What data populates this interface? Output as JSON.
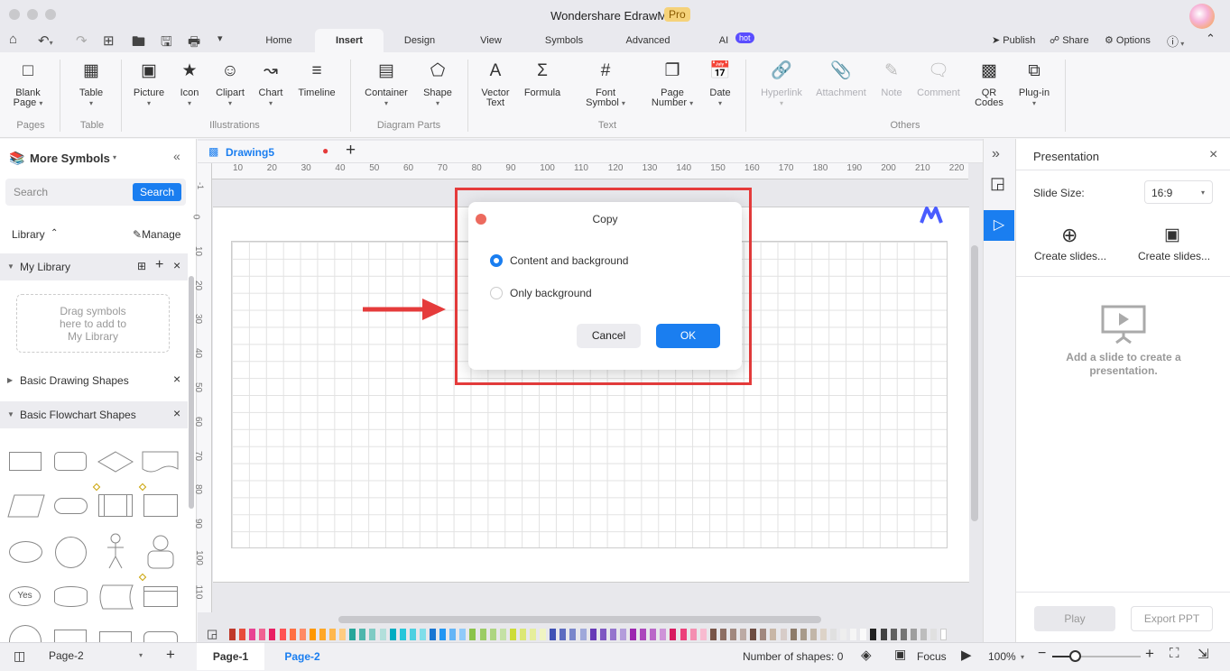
{
  "window": {
    "title": "Wondershare EdrawMax",
    "badge": "Pro"
  },
  "menu_tabs": [
    "Home",
    "Insert",
    "Design",
    "View",
    "Symbols",
    "Advanced",
    "AI"
  ],
  "ai_badge": "hot",
  "top_actions": {
    "publish": "Publish",
    "share": "Share",
    "options": "Options"
  },
  "ribbon": {
    "pages": {
      "blank_page_1": "Blank",
      "blank_page_2": "Page",
      "group": "Pages"
    },
    "table": {
      "label": "Table",
      "group": "Table"
    },
    "illustrations": {
      "picture": "Picture",
      "icon": "Icon",
      "clipart": "Clipart",
      "chart": "Chart",
      "timeline": "Timeline",
      "group": "Illustrations"
    },
    "diagram_parts": {
      "container": "Container",
      "shape": "Shape",
      "group": "Diagram Parts"
    },
    "text": {
      "vector_1": "Vector",
      "vector_2": "Text",
      "formula": "Formula",
      "font_symbol_1": "Font",
      "font_symbol_2": "Symbol",
      "page_number_1": "Page",
      "page_number_2": "Number",
      "date": "Date",
      "group": "Text"
    },
    "others": {
      "hyperlink": "Hyperlink",
      "attachment": "Attachment",
      "note": "Note",
      "comment": "Comment",
      "qr_1": "QR",
      "qr_2": "Codes",
      "plugin": "Plug-in",
      "group": "Others"
    }
  },
  "left_panel": {
    "title": "More Symbols",
    "search_placeholder": "Search",
    "search_button": "Search",
    "library": "Library",
    "manage": "Manage",
    "my_library": "My Library",
    "drag_hint_1": "Drag symbols",
    "drag_hint_2": "here to add to",
    "drag_hint_3": "My Library",
    "basic_drawing": "Basic Drawing Shapes",
    "basic_flowchart": "Basic Flowchart Shapes",
    "yes_shape": "Yes"
  },
  "document_tab": "Drawing5",
  "ruler_h": [
    "10",
    "20",
    "30",
    "40",
    "50",
    "60",
    "70",
    "80",
    "90",
    "100",
    "110",
    "120",
    "130",
    "140",
    "150",
    "160",
    "170",
    "180",
    "190",
    "200",
    "210",
    "220"
  ],
  "ruler_v": [
    "0",
    "10",
    "20",
    "30",
    "40",
    "50",
    "60",
    "70",
    "80",
    "90",
    "100",
    "110"
  ],
  "ruler_v_top": "-1",
  "dialog": {
    "title": "Copy",
    "option1": "Content and background",
    "option2": "Only background",
    "cancel": "Cancel",
    "ok": "OK"
  },
  "right_panel": {
    "title": "Presentation",
    "slide_size_label": "Slide Size:",
    "slide_size_value": "16:9",
    "create1": "Create slides...",
    "create2": "Create slides...",
    "empty_1": "Add a slide to create a",
    "empty_2": "presentation.",
    "play": "Play",
    "export": "Export PPT"
  },
  "status": {
    "page_select": "Page-2",
    "page1": "Page-1",
    "page2": "Page-2",
    "shapes": "Number of shapes: 0",
    "focus": "Focus",
    "zoom": "100%"
  },
  "palette": [
    "#c0392b",
    "#e74c3c",
    "#e84393",
    "#f06292",
    "#e91e63",
    "#ff5252",
    "#ff7043",
    "#ff8a65",
    "#ff9800",
    "#ffa726",
    "#ffb74d",
    "#ffcc80",
    "#26a69a",
    "#4db6ac",
    "#80cbc4",
    "#b2dfdb",
    "#00acc1",
    "#26c6da",
    "#4dd0e1",
    "#80deea",
    "#1976d2",
    "#2196f3",
    "#64b5f6",
    "#90caf9",
    "#8bc34a",
    "#9ccc65",
    "#aed581",
    "#c5e1a5",
    "#cddc39",
    "#dce775",
    "#e6ee9c",
    "#f0f4c3",
    "#3f51b5",
    "#5c6bc0",
    "#7986cb",
    "#9fa8da",
    "#673ab7",
    "#7e57c2",
    "#9575cd",
    "#b39ddb",
    "#9c27b0",
    "#ab47bc",
    "#ba68c8",
    "#ce93d8",
    "#d81b60",
    "#ec407a",
    "#f48fb1",
    "#f8bbd0",
    "#795548",
    "#8d6e63",
    "#a1887f",
    "#bcaaa4",
    "#6d4c41",
    "#a1887f",
    "#c8b6a6",
    "#d7ccc8",
    "#8d7b6a",
    "#a89a8a",
    "#c2b6a8",
    "#ddd3c8",
    "#e0e0e0",
    "#eeeeee",
    "#f5f5f5",
    "#fafafa",
    "#212121",
    "#424242",
    "#616161",
    "#757575",
    "#9e9e9e",
    "#bdbdbd",
    "#e0e0e0",
    "#ffffff"
  ]
}
